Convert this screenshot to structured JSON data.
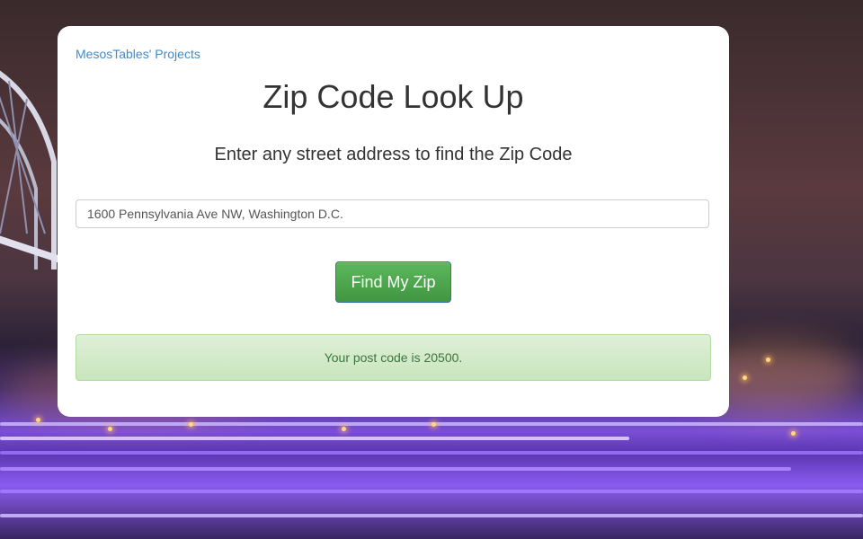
{
  "header": {
    "projects_link": "MesosTables' Projects"
  },
  "main": {
    "title": "Zip Code Look Up",
    "subtitle": "Enter any street address to find the Zip Code",
    "address_value": "1600 Pennsylvania Ave NW, Washington D.C.",
    "button_label": "Find My Zip",
    "result_text": "Your post code is 20500."
  },
  "colors": {
    "link": "#428bca",
    "button": "#5cb85c",
    "alert_bg": "#dff0d8",
    "alert_text": "#3c763d"
  }
}
